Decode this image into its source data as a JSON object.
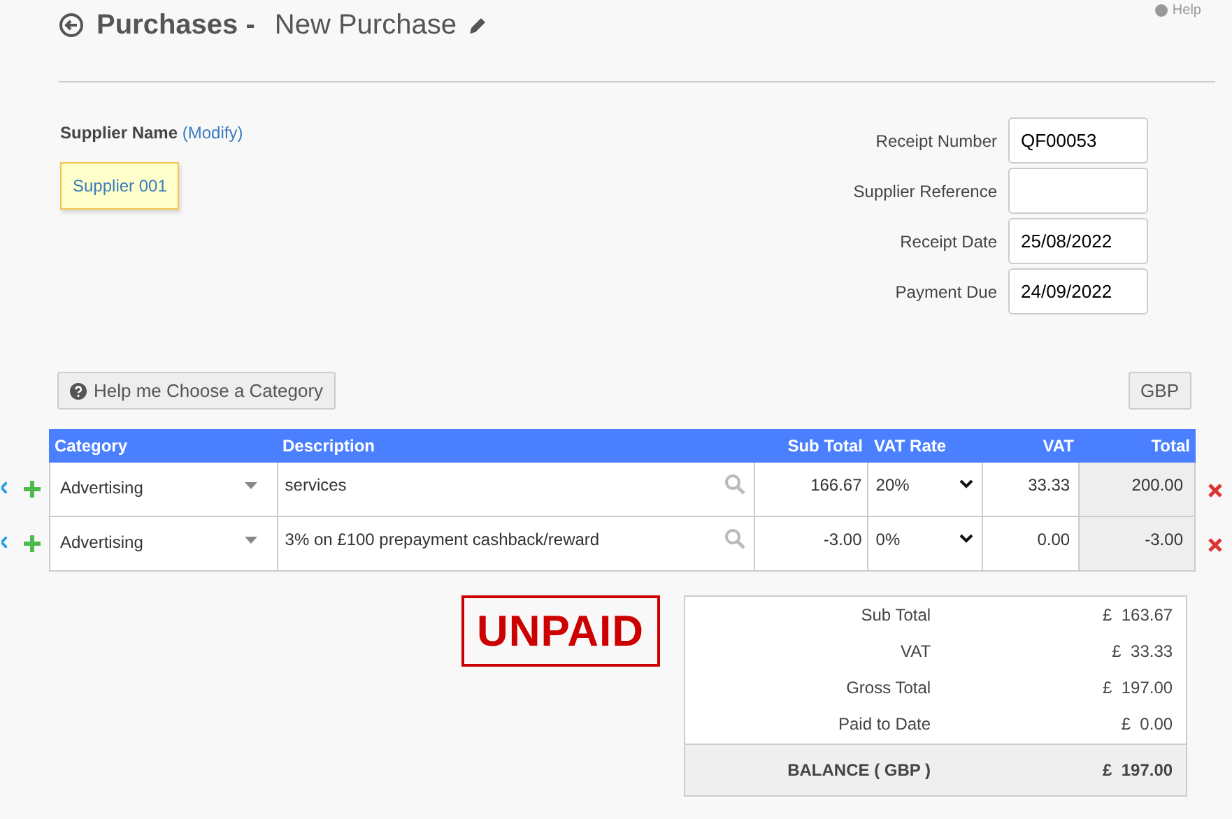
{
  "header": {
    "title": "Purchases -",
    "subtitle": "New Purchase",
    "help": "Help"
  },
  "supplier": {
    "label": "Supplier Name",
    "modify": "(Modify)",
    "name": "Supplier 001"
  },
  "fields": [
    {
      "label": "Receipt Number",
      "value": "QF00053"
    },
    {
      "label": "Supplier Reference"
    },
    {
      "label": "Receipt Date",
      "value": "25/08/2022"
    },
    {
      "label": "Payment Due",
      "value": "24/09/2022"
    }
  ],
  "category_help_button": "Help me Choose a Category",
  "currency_button": "GBP",
  "table": {
    "columns": [
      "Category",
      "Description",
      "Sub Total",
      "VAT Rate",
      "VAT",
      "Total"
    ],
    "rows": [
      {
        "category": "Advertising",
        "description": "services",
        "sub_total": "166.67",
        "vat_rate": "20%",
        "vat": "33.33",
        "total": "200.00"
      },
      {
        "category": "Advertising",
        "description": "3% on £100 prepayment cashback/reward",
        "sub_total": "-3.00",
        "vat_rate": "0%",
        "vat": "0.00",
        "total": "-3.00"
      }
    ]
  },
  "status_stamp": "UNPAID",
  "summary": {
    "rows": [
      {
        "label": "Sub Total",
        "currency": "£",
        "amount": "163.67"
      },
      {
        "label": "VAT",
        "currency": "£",
        "amount": "33.33"
      },
      {
        "label": "Gross Total",
        "currency": "£",
        "amount": "197.00"
      },
      {
        "label": "Paid to Date",
        "currency": "£",
        "amount": "0.00"
      }
    ],
    "balance": {
      "label": "BALANCE ( GBP )",
      "currency": "£",
      "amount": "197.00"
    }
  }
}
